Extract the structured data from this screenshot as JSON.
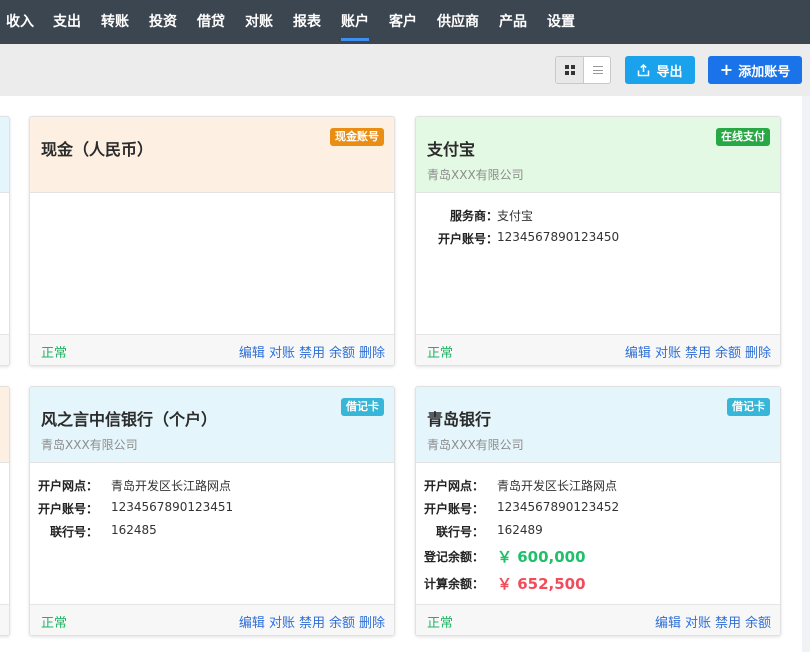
{
  "nav": {
    "items": [
      {
        "label": "收入"
      },
      {
        "label": "支出"
      },
      {
        "label": "转账"
      },
      {
        "label": "投资"
      },
      {
        "label": "借贷"
      },
      {
        "label": "对账"
      },
      {
        "label": "报表"
      },
      {
        "label": "账户",
        "active": true
      },
      {
        "label": "客户"
      },
      {
        "label": "供应商"
      },
      {
        "label": "产品"
      },
      {
        "label": "设置"
      }
    ]
  },
  "toolbar": {
    "export_label": "导出",
    "add_label": "添加账号",
    "view_mode": "grid"
  },
  "colors": {
    "nav_bg": "#3c4650",
    "accent": "#1a73e8",
    "status_ok": "#20b364",
    "balance_green": "#20c06a",
    "balance_red": "#f24b5b"
  },
  "cards": [
    {
      "title": "现金（人民币）",
      "subtitle": "",
      "badge": "现金账号",
      "badge_color": "#ea8d13",
      "header_bg": "#fdf0e2",
      "fields": [],
      "status": "正常",
      "actions": [
        "编辑",
        "对账",
        "禁用",
        "余额",
        "删除"
      ]
    },
    {
      "title": "支付宝",
      "subtitle": "青岛XXX有限公司",
      "badge": "在线支付",
      "badge_color": "#28a745",
      "header_bg": "#e3f9e3",
      "fields": [
        {
          "label": "服务商：",
          "value": "支付宝"
        },
        {
          "label": "开户账号：",
          "value": "1234567890123450"
        }
      ],
      "status": "正常",
      "actions": [
        "编辑",
        "对账",
        "禁用",
        "余额",
        "删除"
      ]
    },
    {
      "title": "风之言中信银行（个户）",
      "subtitle": "青岛XXX有限公司",
      "badge": "借记卡",
      "badge_color": "#38b6d8",
      "header_bg": "#e4f5fb",
      "fields": [
        {
          "label": "开户网点：",
          "value": "青岛开发区长江路网点"
        },
        {
          "label": "开户账号：",
          "value": "1234567890123451"
        },
        {
          "label": "联行号：",
          "value": "162485"
        }
      ],
      "status": "正常",
      "actions": [
        "编辑",
        "对账",
        "禁用",
        "余额",
        "删除"
      ]
    },
    {
      "title": "青岛银行",
      "subtitle": "青岛XXX有限公司",
      "badge": "借记卡",
      "badge_color": "#38b6d8",
      "header_bg": "#e4f5fb",
      "fields": [
        {
          "label": "开户网点：",
          "value": "青岛开发区长江路网点"
        },
        {
          "label": "开户账号：",
          "value": "1234567890123452"
        },
        {
          "label": "联行号：",
          "value": "162489"
        },
        {
          "label": "登记余额：",
          "value": "￥ 600,000",
          "style": "green"
        },
        {
          "label": "计算余额：",
          "value": "￥ 652,500",
          "style": "red"
        }
      ],
      "status": "正常",
      "actions": [
        "编辑",
        "对账",
        "禁用",
        "余额"
      ]
    }
  ]
}
